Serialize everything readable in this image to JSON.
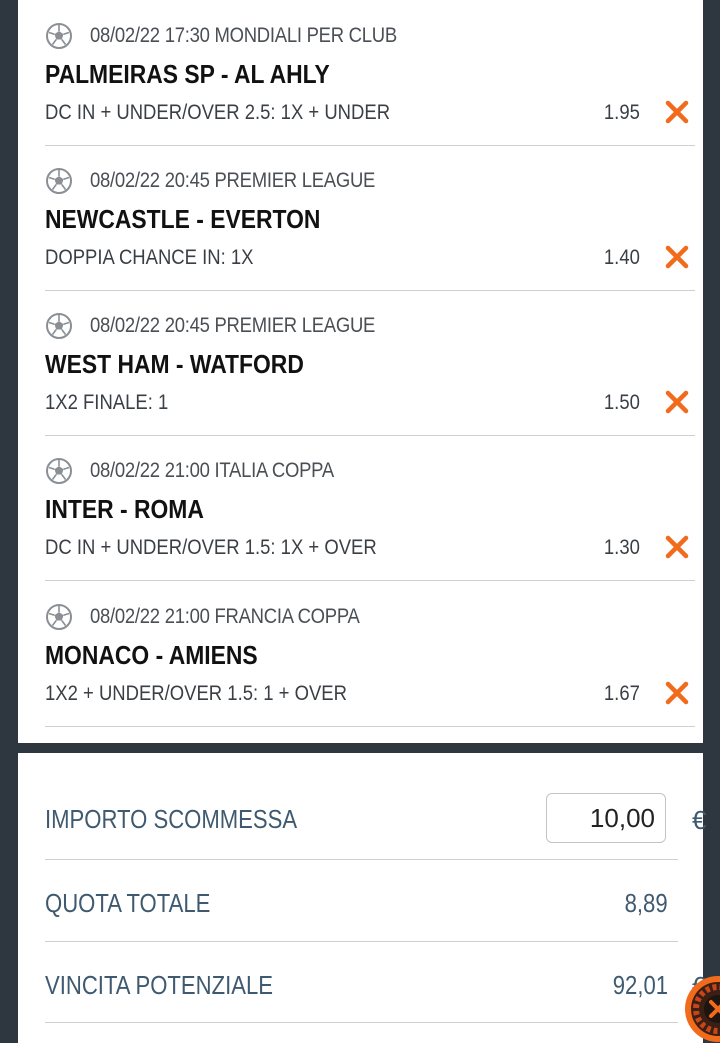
{
  "bets": [
    {
      "meta": "08/02/22 17:30 MONDIALI PER CLUB",
      "match": "PALMEIRAS SP - AL AHLY",
      "selection": "DC IN + UNDER/OVER 2.5: 1X + UNDER",
      "odds": "1.95"
    },
    {
      "meta": "08/02/22 20:45 PREMIER LEAGUE",
      "match": "NEWCASTLE - EVERTON",
      "selection": "DOPPIA CHANCE IN: 1X",
      "odds": "1.40"
    },
    {
      "meta": "08/02/22 20:45 PREMIER LEAGUE",
      "match": "WEST HAM - WATFORD",
      "selection": "1X2 FINALE: 1",
      "odds": "1.50"
    },
    {
      "meta": "08/02/22 21:00 ITALIA COPPA",
      "match": "INTER - ROMA",
      "selection": "DC IN + UNDER/OVER 1.5: 1X + OVER",
      "odds": "1.30"
    },
    {
      "meta": "08/02/22 21:00 FRANCIA COPPA",
      "match": "MONACO - AMIENS",
      "selection": "1X2 + UNDER/OVER 1.5: 1 + OVER",
      "odds": "1.67"
    }
  ],
  "summary": {
    "stake_label": "IMPORTO SCOMMESSA",
    "stake_value": "10,00",
    "stake_currency": "€",
    "total_odds_label": "QUOTA TOTALE",
    "total_odds_value": "8,89",
    "potential_win_label": "VINCITA POTENZIALE",
    "potential_win_value": "92,01",
    "potential_win_currency": "€"
  },
  "icons": {
    "sport": "soccer-ball-icon",
    "remove": "close-icon",
    "floating": "roulette-icon"
  },
  "colors": {
    "remove_accent": "#f26a1b",
    "summary_text": "#3f5a70",
    "background": "#2e3640"
  }
}
